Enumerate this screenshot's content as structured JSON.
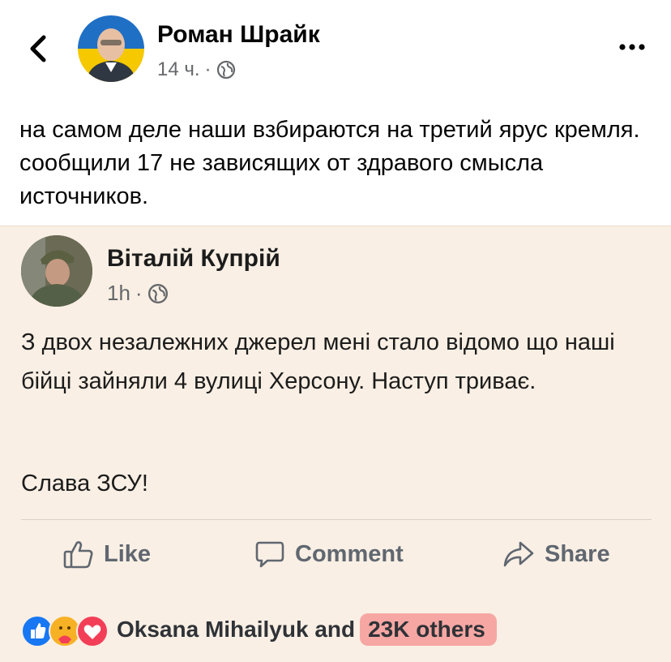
{
  "header": {
    "author": "Роман Шрайк",
    "time": "14 ч.",
    "separator": "·"
  },
  "post": {
    "text": "на самом деле наши взбираются на третий ярус кремля. сообщили 17 не зависящих от здравого смысла источников."
  },
  "shared": {
    "author": "Віталій Купрій",
    "time": "1h",
    "separator": "·",
    "text": "З двох незалежних джерел мені стало відомо що наші бійці зайняли 4 вулиці Херсону. Наступ триває.",
    "closing": "Слава ЗСУ!",
    "actions": {
      "like": "Like",
      "comment": "Comment",
      "share": "Share"
    },
    "reactions": {
      "names": "Oksana Mihailyuk and",
      "others": "23K others"
    }
  },
  "colors": {
    "shared_bg": "#f9efe4",
    "highlight": "#f6a7a3",
    "like_blue": "#1877f2",
    "love_red": "#f33e58",
    "care_yellow": "#f7b125"
  },
  "icons": [
    "back-arrow-icon",
    "globe-icon",
    "more-options-icon",
    "like-thumb-icon",
    "comment-bubble-icon",
    "share-arrow-icon",
    "reaction-like-icon",
    "reaction-care-icon",
    "reaction-love-icon"
  ]
}
